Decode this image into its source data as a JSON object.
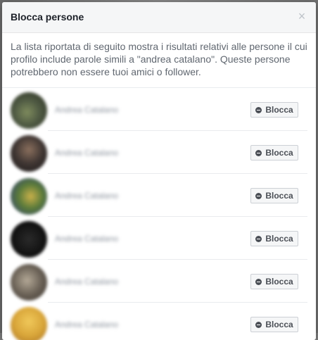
{
  "dialog": {
    "title": "Blocca persone",
    "close_symbol": "×",
    "description": "La lista riportata di seguito mostra i risultati relativi alle persone il cui profilo include parole simili a \"andrea catalano\". Queste persone potrebbero non essere tuoi amici o follower."
  },
  "results": [
    {
      "name": "Andrea Catalano",
      "action_label": "Blocca",
      "avatar_color": "#4f5a43"
    },
    {
      "name": "Andrea Catalano",
      "action_label": "Blocca",
      "avatar_color": "#3e3532"
    },
    {
      "name": "Andrea Catalano",
      "action_label": "Blocca",
      "avatar_color": "#5a7a3a"
    },
    {
      "name": "Andrea Catalano",
      "action_label": "Blocca",
      "avatar_color": "#121212"
    },
    {
      "name": "Andrea Catalano",
      "action_label": "Blocca",
      "avatar_color": "#6b6257"
    },
    {
      "name": "Andrea Catalano",
      "action_label": "Blocca",
      "avatar_color": "#d9a63a"
    }
  ],
  "icons": {
    "close": "close-icon",
    "block": "block-icon"
  }
}
